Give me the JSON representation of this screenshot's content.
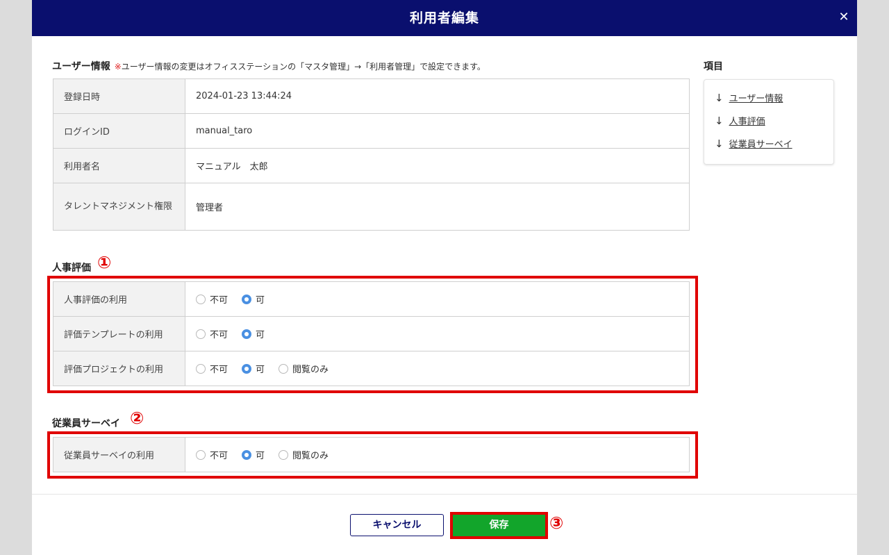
{
  "header": {
    "title": "利用者編集",
    "close_label": "✕"
  },
  "user_info": {
    "title": "ユーザー情報",
    "note_mark": "※",
    "note": "ユーザー情報の変更はオフィスステーションの「マスタ管理」→「利用者管理」で設定できます。",
    "rows": [
      {
        "label": "登録日時",
        "value": "2024-01-23 13:44:24"
      },
      {
        "label": "ログインID",
        "value": "manual_taro"
      },
      {
        "label": "利用者名",
        "value": "マニュアル　太郎"
      },
      {
        "label": "タレントマネジメント権限",
        "value": "管理者"
      }
    ]
  },
  "hr_eval": {
    "title": "人事評価",
    "marker": "①",
    "rows": [
      {
        "label": "人事評価の利用",
        "options": [
          "不可",
          "可"
        ],
        "selected": "可"
      },
      {
        "label": "評価テンプレートの利用",
        "options": [
          "不可",
          "可"
        ],
        "selected": "可"
      },
      {
        "label": "評価プロジェクトの利用",
        "options": [
          "不可",
          "可",
          "閲覧のみ"
        ],
        "selected": "可"
      }
    ]
  },
  "survey": {
    "title": "従業員サーベイ",
    "marker": "②",
    "rows": [
      {
        "label": "従業員サーベイの利用",
        "options": [
          "不可",
          "可",
          "閲覧のみ"
        ],
        "selected": "可"
      }
    ]
  },
  "toc": {
    "title": "項目",
    "arrow": "↓",
    "items": [
      "ユーザー情報",
      "人事評価",
      "従業員サーベイ"
    ]
  },
  "footer": {
    "cancel_label": "キャンセル",
    "save_label": "保存",
    "marker": "③"
  },
  "colors": {
    "header_bg": "#0a0f6e",
    "save_bg": "#12a52b",
    "highlight": "#e00000",
    "radio_selected": "#4a90e2"
  }
}
